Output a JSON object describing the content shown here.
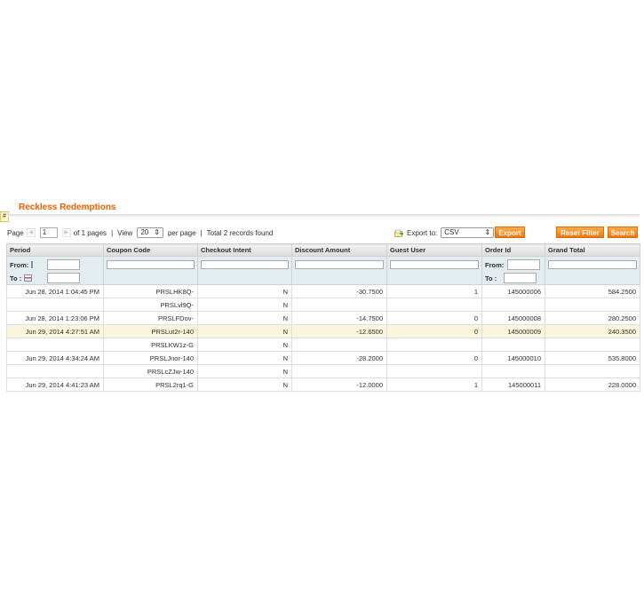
{
  "section_title": "Reckless Redemptions",
  "anchor_glyph": "#",
  "pager": {
    "page_label": "Page",
    "page_value": "1",
    "of_pages": "of 1 pages",
    "view_label": "View",
    "per_page_value": "20",
    "per_page_label": "per page",
    "total_records": "Total 2 records found",
    "separator": "|"
  },
  "export": {
    "label": "Export to:",
    "format": "CSV",
    "button": "Export"
  },
  "buttons": {
    "reset_filter": "Reset Filter",
    "search": "Search"
  },
  "filters": {
    "from_label": "From:",
    "to_label": "To :"
  },
  "columns": [
    "Period",
    "Coupon Code",
    "Checkout Intent",
    "Discount Amount",
    "Guest User",
    "Order Id",
    "Grand Total"
  ],
  "rows": [
    {
      "period": "Jun 28, 2014 1:04:45 PM",
      "coupon": "PRSLHK8Q-",
      "intent": "N",
      "discount": "-30.7500",
      "guest": "1",
      "order": "145000006",
      "total": "584.2500",
      "highlight": false
    },
    {
      "period": "",
      "coupon": "PRSLvl9Q-",
      "intent": "N",
      "discount": "",
      "guest": "",
      "order": "",
      "total": "",
      "highlight": false
    },
    {
      "period": "Jun 28, 2014 1:23:06 PM",
      "coupon": "PRSLFDov-",
      "intent": "N",
      "discount": "-14.7500",
      "guest": "0",
      "order": "145000008",
      "total": "280.2500",
      "highlight": false
    },
    {
      "period": "Jun 29, 2014 4:27:51 AM",
      "coupon": "PRSLut2r-140",
      "intent": "N",
      "discount": "-12.6500",
      "guest": "0",
      "order": "145000009",
      "total": "240.3500",
      "highlight": true
    },
    {
      "period": "",
      "coupon": "PRSLKW1z-G",
      "intent": "N",
      "discount": "",
      "guest": "",
      "order": "",
      "total": "",
      "highlight": false
    },
    {
      "period": "Jun 29, 2014 4:34:24 AM",
      "coupon": "PRSLJnor-140",
      "intent": "N",
      "discount": "-28.2000",
      "guest": "0",
      "order": "145000010",
      "total": "535.8000",
      "highlight": false
    },
    {
      "period": "",
      "coupon": "PRSLcZJw-140",
      "intent": "N",
      "discount": "",
      "guest": "",
      "order": "",
      "total": "",
      "highlight": false
    },
    {
      "period": "Jun 29, 2014 4:41:23 AM",
      "coupon": "PRSL2rq1-G",
      "intent": "N",
      "discount": "-12.0000",
      "guest": "1",
      "order": "145000011",
      "total": "228.0000",
      "highlight": false
    }
  ],
  "colors": {
    "accent": "#eb5e00",
    "button": "#f0760c",
    "filter_row": "#e3ecee",
    "highlight_row": "#fcf5dd"
  }
}
